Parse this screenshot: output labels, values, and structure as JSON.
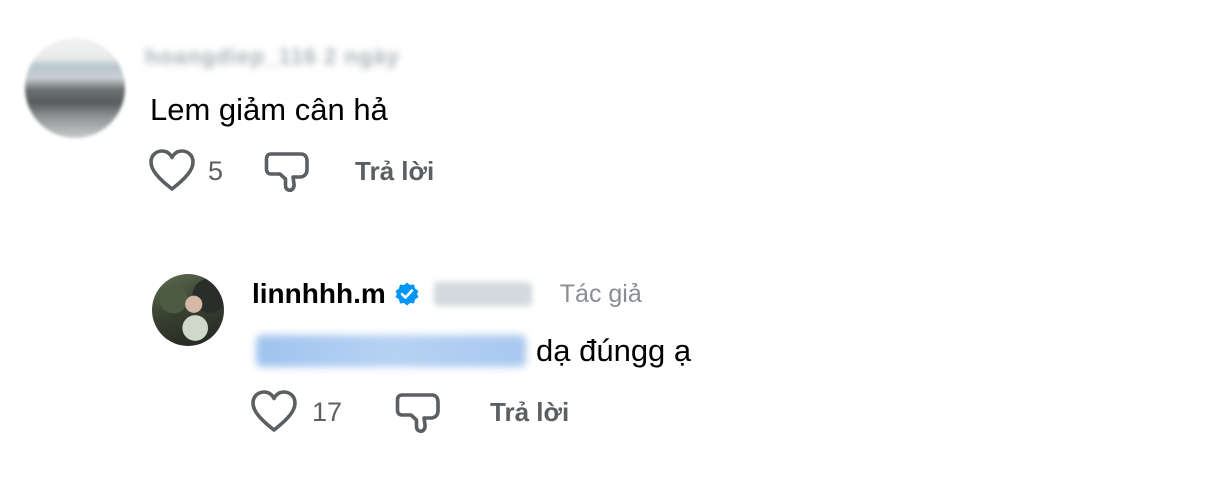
{
  "comment": {
    "username": "hoangdiep_116 2 ngày",
    "text": "Lem giảm cân hả",
    "like_count": "5",
    "reply_label": "Trả lời"
  },
  "reply": {
    "username": "linnhhh.m",
    "author_label": "Tác giả",
    "text": "dạ đúngg ạ",
    "like_count": "17",
    "reply_label": "Trả lời"
  },
  "colors": {
    "verified_blue": "#0095f6",
    "icon_stroke": "#5c5f62",
    "meta_gray": "#8a8e92"
  },
  "icons": {
    "like": "heart-icon",
    "dislike": "thumbs-down-icon",
    "verified": "verified-badge-icon"
  }
}
